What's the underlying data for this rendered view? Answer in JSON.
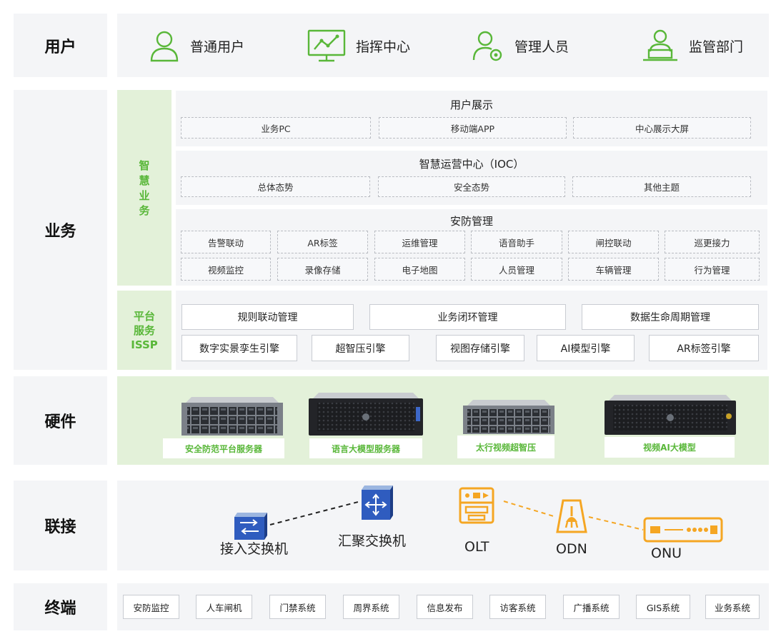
{
  "layers": {
    "users": "用户",
    "business": "业务",
    "hardware": "硬件",
    "connect": "联接",
    "terminal": "终端"
  },
  "users": [
    {
      "label": "普通用户",
      "icon": "person-icon"
    },
    {
      "label": "指挥中心",
      "icon": "monitor-chart-icon"
    },
    {
      "label": "管理人员",
      "icon": "person-gear-icon"
    },
    {
      "label": "监管部门",
      "icon": "person-laptop-icon"
    }
  ],
  "smart_business": {
    "label_chars": [
      "智",
      "慧",
      "业",
      "务"
    ],
    "display": {
      "title": "用户展示",
      "items": [
        "业务PC",
        "移动端APP",
        "中心展示大屏"
      ]
    },
    "ioc": {
      "title": "智慧运营中心（IOC）",
      "items": [
        "总体态势",
        "安全态势",
        "其他主题"
      ]
    },
    "security": {
      "title": "安防管理",
      "row1": [
        "告警联动",
        "AR标签",
        "运维管理",
        "语音助手",
        "闸控联动",
        "巡更接力"
      ],
      "row2": [
        "视频监控",
        "录像存储",
        "电子地图",
        "人员管理",
        "车辆管理",
        "行为管理"
      ]
    }
  },
  "platform": {
    "label_lines": [
      "平台",
      "服务",
      "ISSP"
    ],
    "row1": [
      "规则联动管理",
      "业务闭环管理",
      "数据生命周期管理"
    ],
    "row2": [
      "数字实景孪生引擎",
      "超智压引擎",
      "视图存储引擎",
      "AI模型引擎",
      "AR标签引擎"
    ]
  },
  "hardware": [
    "安全防范平台服务器",
    "语言大模型服务器",
    "太行视频超智压",
    "视频AI大模型"
  ],
  "network": {
    "access_switch": "接入交换机",
    "aggregation_switch": "汇聚交换机",
    "olt": "OLT",
    "odn": "ODN",
    "onu": "ONU"
  },
  "terminals": [
    "安防监控",
    "人车闸机",
    "门禁系统",
    "周界系统",
    "信息发布",
    "访客系统",
    "广播系统",
    "GIS系统",
    "业务系统"
  ],
  "colors": {
    "green": "#59b739",
    "green_bg": "#e3f1d9",
    "orange": "#f5a623",
    "panel": "#f4f5f7"
  }
}
